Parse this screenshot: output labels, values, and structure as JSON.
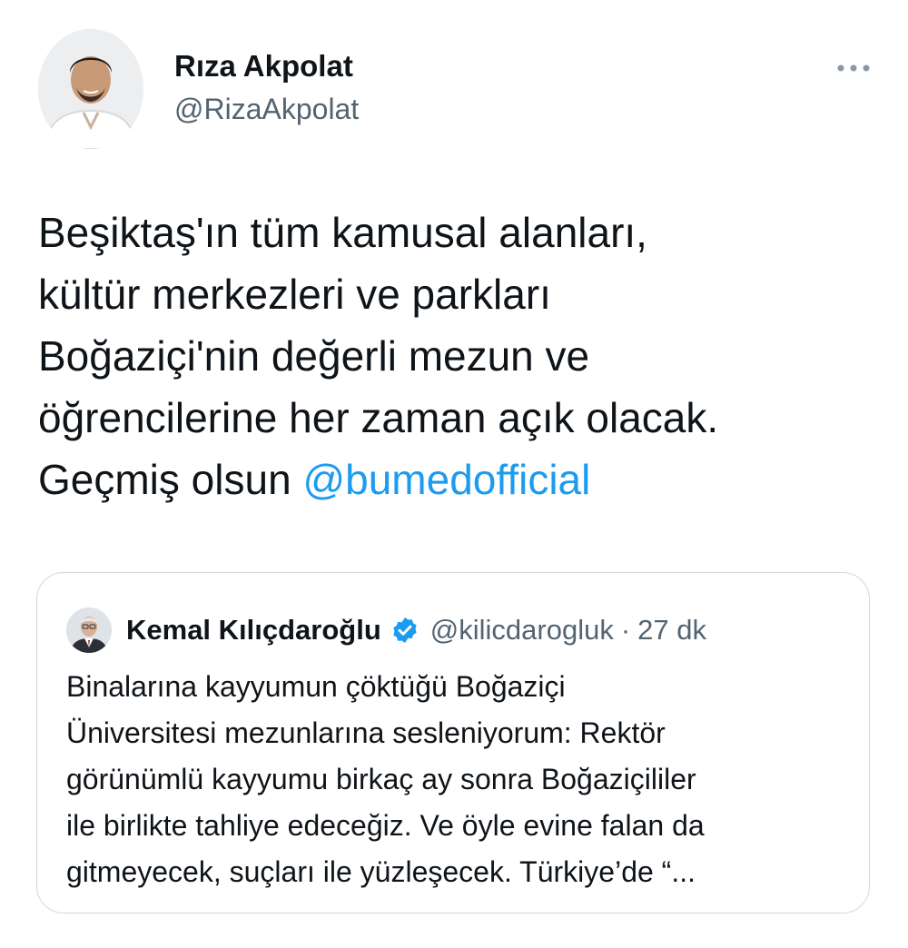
{
  "author": {
    "display_name": "Rıza Akpolat",
    "handle": "@RizaAkpolat",
    "avatar_icon": "profile-photo"
  },
  "more_icon": "more-dots-icon",
  "tweet": {
    "text": "Beşiktaş'ın tüm kamusal alanları,\nkültür merkezleri ve parkları\nBoğaziçi'nin değerli mezun ve\nöğrencilerine her zaman açık olacak.\nGeçmiş olsun ",
    "mention": "@bumedofficial"
  },
  "quoted_tweet": {
    "display_name": "Kemal Kılıçdaroğlu",
    "verified_icon": "verified-badge-icon",
    "handle": "@kilicdarogluk",
    "separator": "·",
    "time": "27 dk",
    "text": "Binalarına kayyumun çöktüğü Boğaziçi\nÜniversitesi mezunlarına sesleniyorum: Rektör\ngörünümlü kayyumu birkaç ay sonra Boğaziçililer\nile birlikte tahliye edeceğiz. Ve öyle evine falan da\ngitmeyecek, suçları ile yüzleşecek. Türkiye’de “..."
  },
  "colors": {
    "text": "#0f1419",
    "secondary": "#536471",
    "link": "#1d9bf0",
    "border": "#cfd9de",
    "verified": "#1d9bf0"
  }
}
